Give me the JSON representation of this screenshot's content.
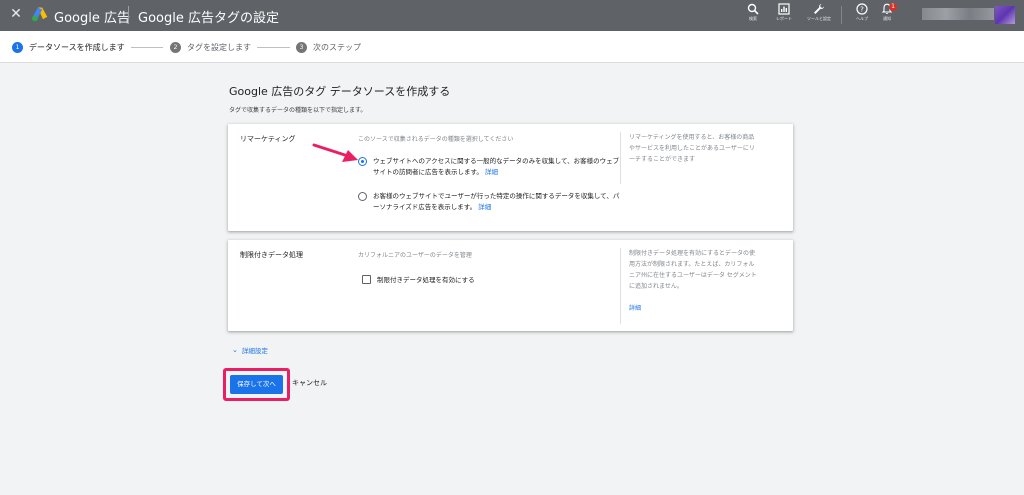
{
  "topbar": {
    "close_icon": "close-icon",
    "app_name": "Google 広告",
    "page_title": "Google 広告タグの設定",
    "buttons": [
      {
        "icon": "search-icon",
        "label": "検索"
      },
      {
        "icon": "reports-icon",
        "label": "レポート"
      },
      {
        "icon": "wrench-icon",
        "label": "ツールと設定"
      },
      {
        "icon": "help-icon",
        "label": "ヘルプ"
      },
      {
        "icon": "bell-icon",
        "label": "通知",
        "badge": "1"
      }
    ]
  },
  "stepper": {
    "steps": [
      {
        "num": "1",
        "label": "データソースを作成します",
        "active": true
      },
      {
        "num": "2",
        "label": "タグを設定します",
        "active": false
      },
      {
        "num": "3",
        "label": "次のステップ",
        "active": false
      }
    ]
  },
  "main": {
    "heading": "Google 広告のタグ データソースを作成する",
    "subheading": "タグで収集するデータの種類を以下で指定します。",
    "remarketing": {
      "title": "リマーケティング",
      "prompt": "このソースで収集されるデータの種類を選択してください",
      "options": [
        {
          "text": "ウェブサイトへのアクセスに関する一般的なデータのみを収集して、お客様のウェブサイトの訪問者に広告を表示します。",
          "link": "詳細",
          "selected": true
        },
        {
          "text": "お客様のウェブサイトでユーザーが行った特定の操作に関するデータを収集して、パーソナライズド広告を表示します。",
          "link": "詳細",
          "selected": false
        }
      ],
      "help": "リマーケティングを使用すると、お客様の商品やサービスを利用したことがあるユーザーにリーチすることができます"
    },
    "restricted": {
      "title": "制限付きデータ処理",
      "prompt": "カリフォルニアのユーザーのデータを管理",
      "checkbox_label": "制限付きデータ処理を有効にする",
      "checked": false,
      "help": "制限付きデータ処理を有効にするとデータの使用方法が制限されます。たとえば、カリフォルニア州に在住するユーザーはデータ セグメントに追加されません。",
      "help_link": "詳細"
    },
    "advanced_settings": "詳細設定",
    "save_button": "保存して次へ",
    "cancel_button": "キャンセル"
  },
  "colors": {
    "accent": "#1a73e8",
    "highlight": "#e91e63",
    "topbar": "#5f6368"
  }
}
